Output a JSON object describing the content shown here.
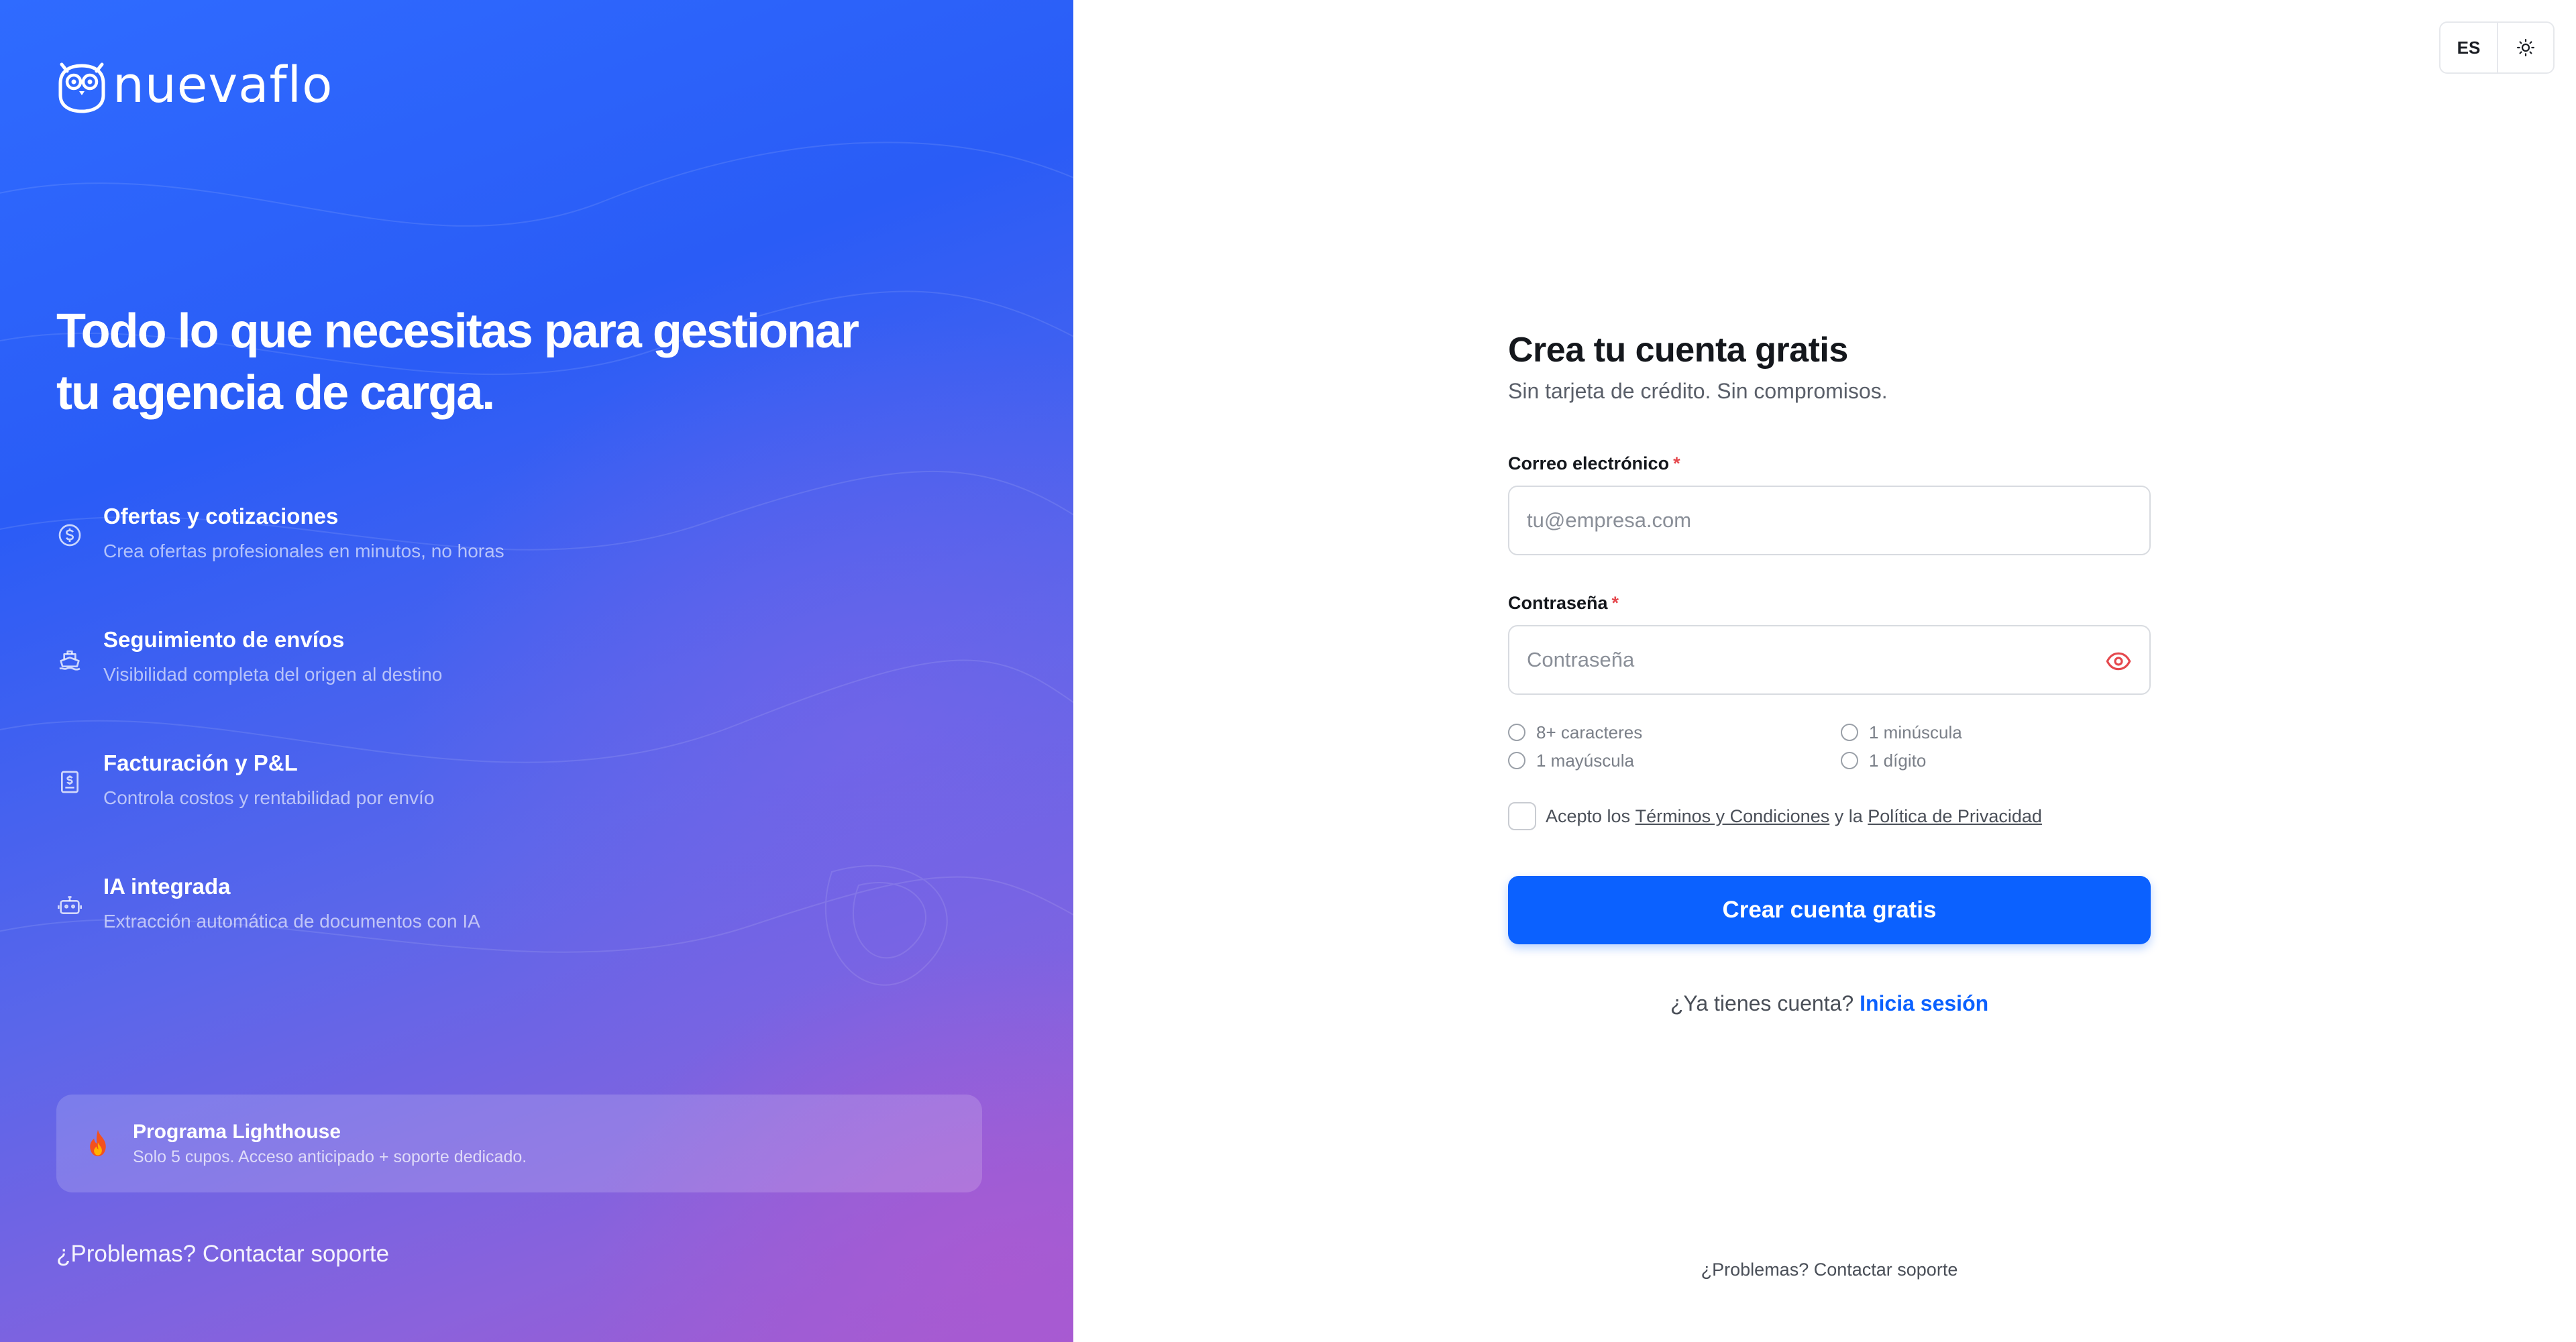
{
  "brand": {
    "name": "nuevaflo"
  },
  "hero": {
    "headline_line1": "Todo lo que necesitas para gestionar",
    "headline_line2": "tu agencia de carga.",
    "features": [
      {
        "icon": "dollar-coin-icon",
        "title": "Ofertas y cotizaciones",
        "description": "Crea ofertas profesionales en minutos, no horas"
      },
      {
        "icon": "ship-icon",
        "title": "Seguimiento de envíos",
        "description": "Visibilidad completa del origen al destino"
      },
      {
        "icon": "invoice-icon",
        "title": "Facturación y P&L",
        "description": "Controla costos y rentabilidad por envío"
      },
      {
        "icon": "robot-icon",
        "title": "IA integrada",
        "description": "Extracción automática de documentos con IA"
      }
    ],
    "program": {
      "icon": "fire-icon",
      "title": "Programa Lighthouse",
      "description": "Solo 5 cupos. Acceso anticipado + soporte dedicado."
    },
    "support_link": "¿Problemas? Contactar soporte"
  },
  "topbar": {
    "language": "ES",
    "theme_icon": "sun-icon"
  },
  "form": {
    "title": "Crea tu cuenta gratis",
    "subtitle": "Sin tarjeta de crédito. Sin compromisos.",
    "email": {
      "label": "Correo electrónico",
      "required_mark": "*",
      "placeholder": "tu@empresa.com",
      "value": ""
    },
    "password": {
      "label": "Contraseña",
      "required_mark": "*",
      "placeholder": "Contraseña",
      "value": ""
    },
    "requirements": [
      "8+ caracteres",
      "1 minúscula",
      "1 mayúscula",
      "1 dígito"
    ],
    "terms": {
      "prefix": "Acepto los",
      "terms_link": "Términos y Condiciones",
      "middle": "y la",
      "privacy_link": "Política de Privacidad"
    },
    "submit_label": "Crear cuenta gratis",
    "login_prompt": "¿Ya tienes cuenta?",
    "login_link": "Inicia sesión"
  },
  "footer": {
    "support_link": "¿Problemas? Contactar soporte"
  },
  "colors": {
    "accent": "#0b61ff",
    "required": "#e5484d",
    "eye_icon": "#e5484d"
  }
}
